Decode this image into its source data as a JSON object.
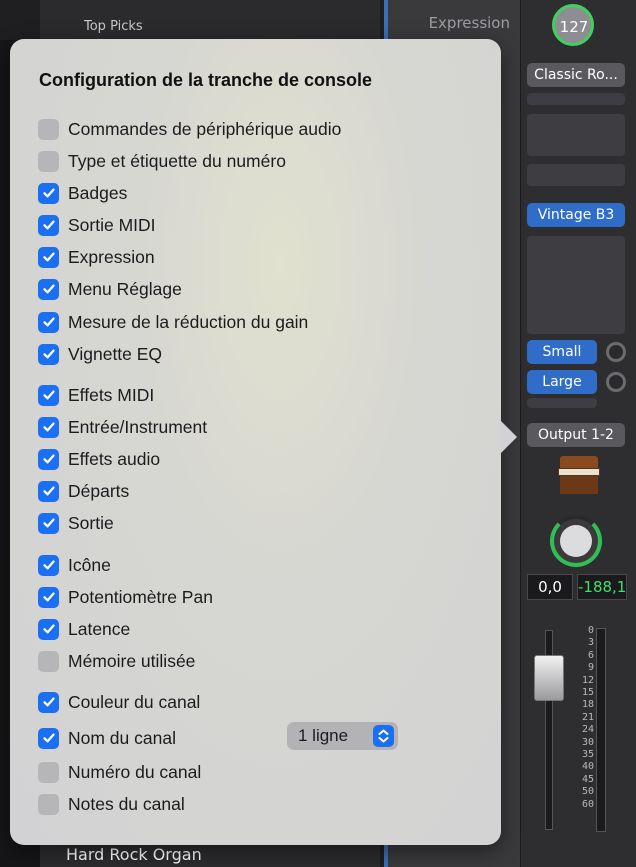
{
  "library": {
    "top_tab": "Top Picks",
    "bottom_item": "Hard Rock Organ"
  },
  "inspector": {
    "expression_label": "Expression"
  },
  "channel_strip": {
    "expression_value": "127",
    "setting_button": "Classic Ro...",
    "eq_patch": "Vintage B3",
    "plugin_small": "Small",
    "plugin_large": "Large",
    "output": "Output 1-2",
    "volume_value": "0,0",
    "peak_value": "-188,1",
    "meter_scale": [
      "0",
      "3",
      "6",
      "9",
      "12",
      "15",
      "18",
      "21",
      "24",
      "30",
      "35",
      "40",
      "45",
      "50",
      "60"
    ]
  },
  "popover": {
    "title": "Configuration de la tranche de console",
    "options": [
      {
        "label": "Commandes de périphérique audio",
        "checked": false
      },
      {
        "label": "Type et étiquette du numéro",
        "checked": false
      },
      {
        "label": "Badges",
        "checked": true
      },
      {
        "label": "Sortie MIDI",
        "checked": true
      },
      {
        "label": "Expression",
        "checked": true
      },
      {
        "label": "Menu Réglage",
        "checked": true
      },
      {
        "label": "Mesure de la réduction du gain",
        "checked": true
      },
      {
        "label": "Vignette EQ",
        "checked": true
      },
      {
        "label": "Effets MIDI",
        "checked": true
      },
      {
        "label": "Entrée/Instrument",
        "checked": true
      },
      {
        "label": "Effets audio",
        "checked": true
      },
      {
        "label": "Départs",
        "checked": true
      },
      {
        "label": "Sortie",
        "checked": true
      },
      {
        "label": "Icône",
        "checked": true
      },
      {
        "label": "Potentiomètre Pan",
        "checked": true
      },
      {
        "label": "Latence",
        "checked": true
      },
      {
        "label": "Mémoire utilisée",
        "checked": false
      },
      {
        "label": "Couleur du canal",
        "checked": true
      },
      {
        "label": "Nom du canal",
        "checked": true
      },
      {
        "label": "Numéro du canal",
        "checked": false
      },
      {
        "label": "Notes du canal",
        "checked": false
      }
    ],
    "name_lines_select": "1 ligne"
  },
  "colors": {
    "accent": "#1a6ff2",
    "checkbox_off": "#b6b6b9",
    "knob_green": "#3fd15d",
    "peak_green": "#3fe06a"
  }
}
